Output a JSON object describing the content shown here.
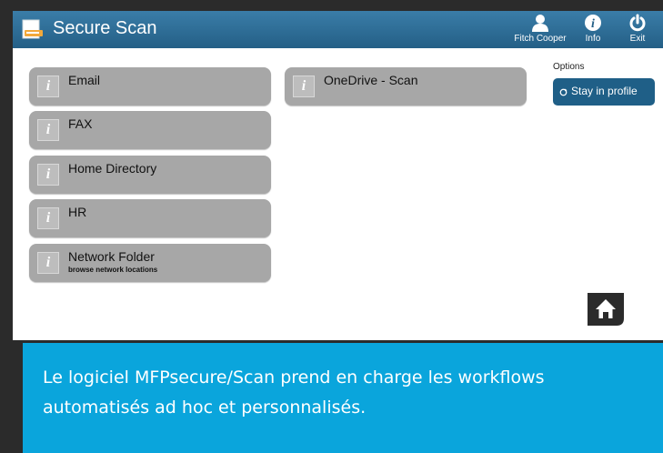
{
  "app": {
    "title": "Secure Scan"
  },
  "toolbar": {
    "user_label": "Fitch Cooper",
    "info_label": "Info",
    "exit_label": "Exit"
  },
  "workflows": [
    {
      "label": "Email",
      "sublabel": ""
    },
    {
      "label": "FAX",
      "sublabel": ""
    },
    {
      "label": "Home Directory",
      "sublabel": ""
    },
    {
      "label": "HR",
      "sublabel": ""
    },
    {
      "label": "Network Folder",
      "sublabel": "browse network locations"
    },
    {
      "label": "OneDrive - Scan",
      "sublabel": ""
    }
  ],
  "info_glyph": "i",
  "options": {
    "heading": "Options",
    "stay_label": "Stay in profile"
  },
  "caption": {
    "text": "Le logiciel MFPsecure/Scan prend en charge les workflows automatisés ad hoc et personnalisés."
  },
  "colors": {
    "titlebar": "#2e6f99",
    "workflow_button": "#a7a7a7",
    "stay_button": "#1f5f87",
    "caption_background": "#0aa5dc"
  },
  "icons": [
    "scanner-icon",
    "user-icon",
    "info-icon",
    "power-icon",
    "info-badge-icon",
    "refresh-icon",
    "home-icon"
  ]
}
